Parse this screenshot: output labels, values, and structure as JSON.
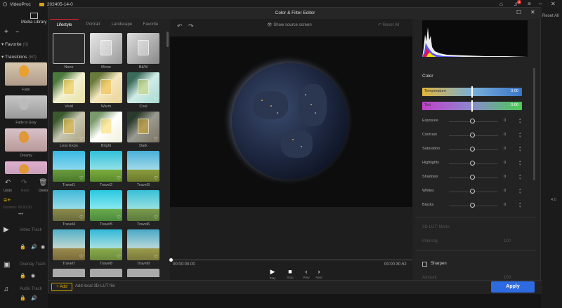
{
  "app": {
    "name": "VideoProc",
    "project": "202405-14-0",
    "notification_count": "1"
  },
  "left": {
    "media_library": "Media Library",
    "favorite_label": "Favorite",
    "favorite_count": "(0)",
    "transitions_label": "Transitions",
    "transitions_count": "(60)",
    "transitions": [
      "Fade",
      "Fade to Gray",
      "Dreamy"
    ],
    "undo": "Undo",
    "redo": "Redo",
    "delete": "Delete",
    "duration_text": "Duration: 00:00:30",
    "tracks": [
      "Video Track",
      "Overlay Track",
      "Audio Track"
    ]
  },
  "editor": {
    "title": "Color & Filter Editor",
    "tabs": [
      "Lifestyle",
      "Portrait",
      "Landscape",
      "Favorite"
    ],
    "filters": [
      "None",
      "Mono",
      "B&W",
      "Vivid",
      "Warm",
      "Cool",
      "Less Expo",
      "Bright",
      "Dark",
      "Travel1",
      "Travel2",
      "Travel3",
      "Travel4",
      "Travel5",
      "Travel6",
      "Travel7",
      "Travel8",
      "Travel9"
    ],
    "show_source": "Show source screen",
    "reset_all": "Reset All",
    "time_current": "00:00:00.00",
    "time_total": "00:00:30.52",
    "controls": [
      "Play",
      "Stop",
      "Prev",
      "Next"
    ],
    "add_label": "+ Add",
    "add_lut": "Add local 3D-LUT file",
    "apply": "Apply"
  },
  "color": {
    "section": "Color",
    "temperature": {
      "label": "Temperature",
      "value": "0.00"
    },
    "tint": {
      "label": "Tint",
      "value": "0.00"
    },
    "sliders": [
      {
        "label": "Exposure",
        "value": "0"
      },
      {
        "label": "Contrast",
        "value": "0"
      },
      {
        "label": "Saturation",
        "value": "0"
      },
      {
        "label": "Highlights",
        "value": "0"
      },
      {
        "label": "Shadows",
        "value": "0"
      },
      {
        "label": "Whites",
        "value": "0"
      },
      {
        "label": "Blacks",
        "value": "0"
      }
    ],
    "lut_section": "3D-LUT: Mono",
    "intensity_label": "Intensity",
    "intensity_value": "100",
    "sharpen_label": "Sharpen",
    "amount_label": "Amount",
    "amount_value": "100"
  },
  "bg": {
    "reset_all": "Reset All",
    "ruler": "4:0"
  }
}
